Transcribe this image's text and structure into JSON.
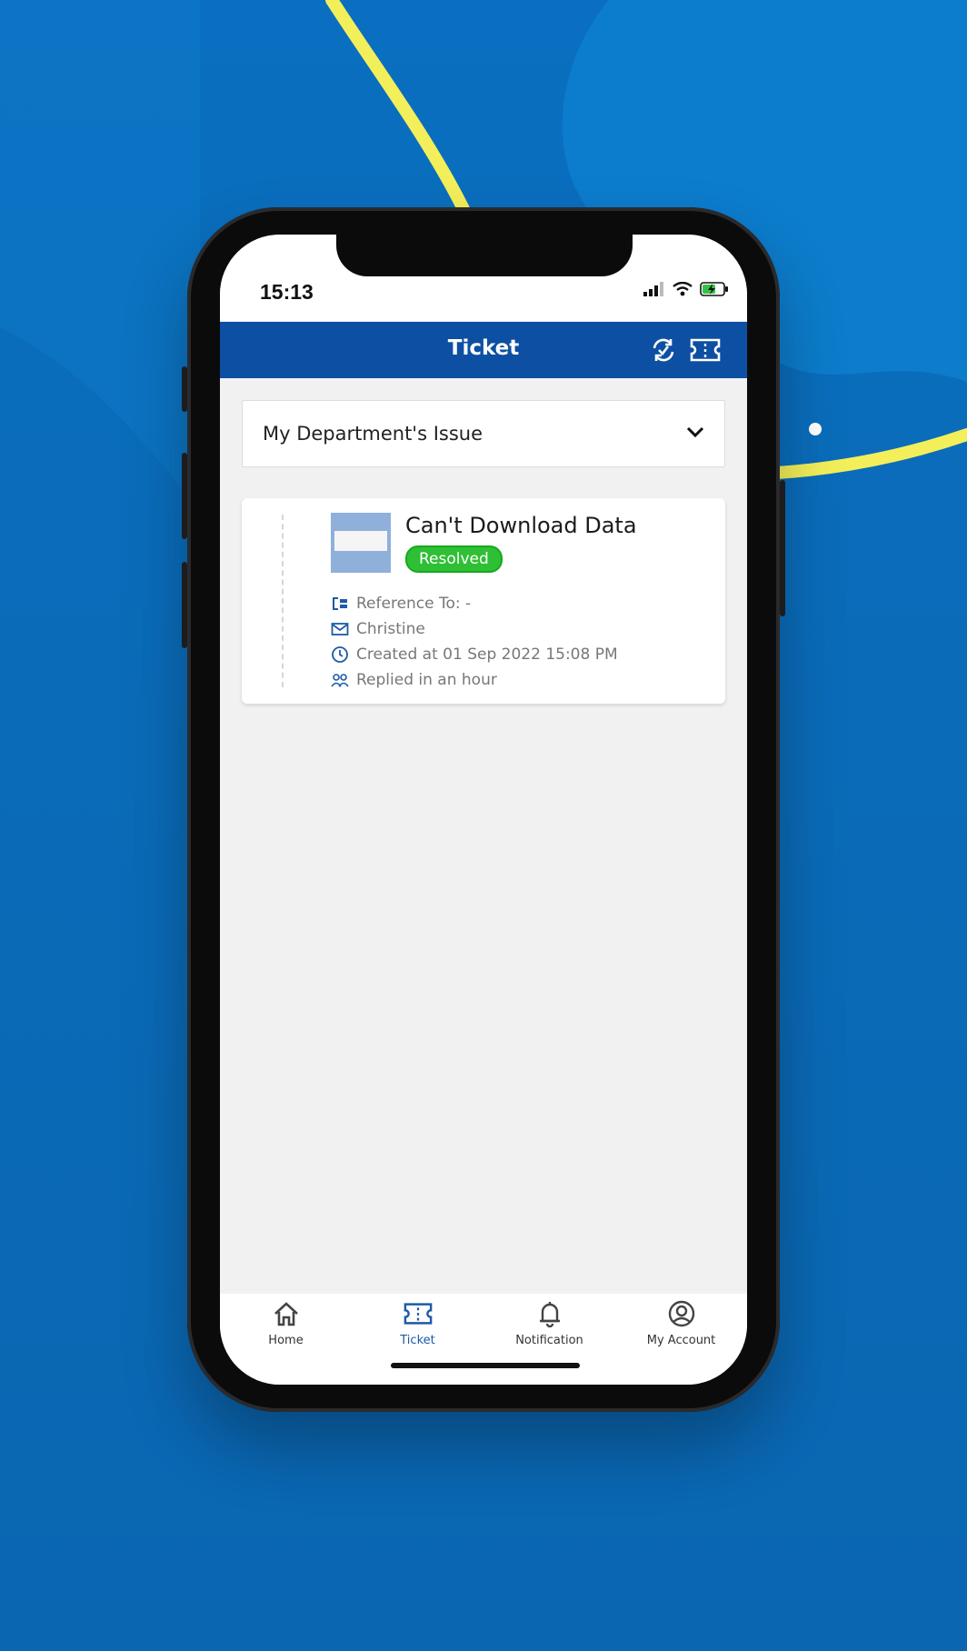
{
  "status_bar": {
    "time": "15:13"
  },
  "header": {
    "title": "Ticket",
    "refresh_icon": "refresh-check-icon",
    "ticket_icon": "ticket-icon"
  },
  "filter": {
    "selected": "My Department's Issue"
  },
  "tickets": [
    {
      "title": "Can't Download Data",
      "status": "Resolved",
      "reference": "Reference To: -",
      "sender": "Christine",
      "created": "Created at 01 Sep 2022 15:08 PM",
      "replied": "Replied in an hour"
    }
  ],
  "bottom_nav": [
    {
      "label": "Home",
      "icon": "home-icon"
    },
    {
      "label": "Ticket",
      "icon": "ticket-icon",
      "active": true
    },
    {
      "label": "Notification",
      "icon": "bell-icon"
    },
    {
      "label": "My Account",
      "icon": "account-icon"
    }
  ],
  "colors": {
    "background": "#0a6bb8",
    "header": "#0d4fa2",
    "accent_yellow": "#f5f05a",
    "resolved": "#2fbf35",
    "active_nav": "#1d5aa8"
  }
}
